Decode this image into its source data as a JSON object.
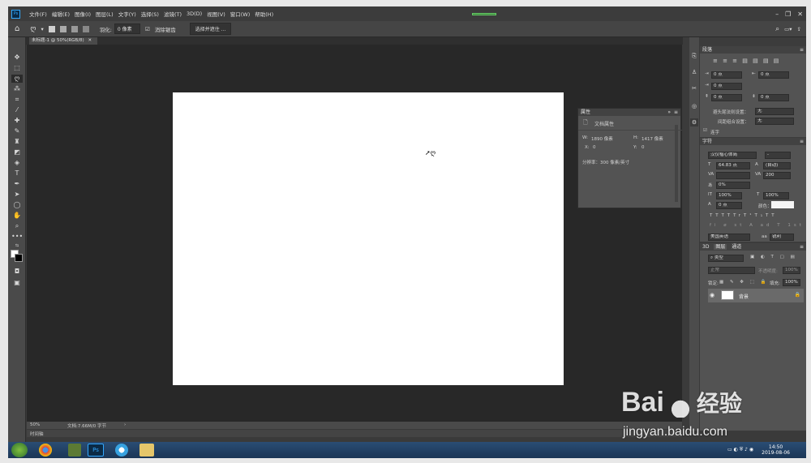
{
  "app": {
    "logo": "Ps"
  },
  "menu": [
    "文件(F)",
    "编辑(E)",
    "图像(I)",
    "图层(L)",
    "文字(Y)",
    "选择(S)",
    "滤镜(T)",
    "3D(D)",
    "视图(V)",
    "窗口(W)",
    "帮助(H)"
  ],
  "window_controls": {
    "minimize": "–",
    "restore": "❐",
    "close": "✕"
  },
  "options": {
    "feather_label": "羽化:",
    "feather_value": "0 像素",
    "antialias_label": "消除锯齿",
    "select_mask_button": "选择并遮住 ..."
  },
  "document": {
    "tab": "未标题-1 @ 50%(RGB/8)",
    "zoom": "50%",
    "doc_info": "文档:7.66M/0 字节"
  },
  "timeline": {
    "label": "时间轴"
  },
  "properties": {
    "title": "属性",
    "section": "文档属性",
    "w_label": "W:",
    "w_value": "1890 像素",
    "h_label": "H:",
    "h_value": "1417 像素",
    "x_label": "X:",
    "x_value": "0",
    "y_label": "Y:",
    "y_value": "0",
    "resolution": "分辨率：300 像素/英寸"
  },
  "paragraph": {
    "title": "段落",
    "indent_left": "0 点",
    "indent_right": "0 点",
    "indent_first": "0 点",
    "space_before": "0 点",
    "space_after": "0 点",
    "kinsoku_label": "避头尾法则设置：",
    "kinsoku_value": "无",
    "mojikumi_label": "间距组合设置：",
    "mojikumi_value": "无",
    "hyphenate_label": "连字"
  },
  "character": {
    "title": "字符",
    "font_family": "汉仪楷心体简",
    "font_style": "-",
    "font_size": "64.83 点",
    "leading": "(自动)",
    "kerning": "",
    "tracking": "200",
    "tsume": "0%",
    "vscale": "100%",
    "hscale": "100%",
    "baseline": "0 点",
    "color_label": "颜色：",
    "color_value": "#f5f5f5",
    "language": "美国英语",
    "aa_label": "aa",
    "aa_value": "锐利",
    "styles": [
      "T",
      "T",
      "TT",
      "Tr",
      "T¹",
      "T₁",
      "T",
      "T"
    ]
  },
  "layers": {
    "tabs": [
      "3D",
      "图层",
      "通道"
    ],
    "filter_placeholder": "类型",
    "blend_mode": "正常",
    "opacity_label": "不透明度:",
    "opacity_value": "100%",
    "lock_label": "锁定:",
    "fill_label": "填充:",
    "fill_value": "100%",
    "items": [
      {
        "name": "背景"
      }
    ]
  },
  "taskbar": {
    "clock_time": "14:50",
    "clock_date": "2019-08-06"
  },
  "watermark": {
    "brand": "Bai",
    "brand2": "百",
    "brand_cn": "经验",
    "url": "jingyan.baidu.com"
  }
}
